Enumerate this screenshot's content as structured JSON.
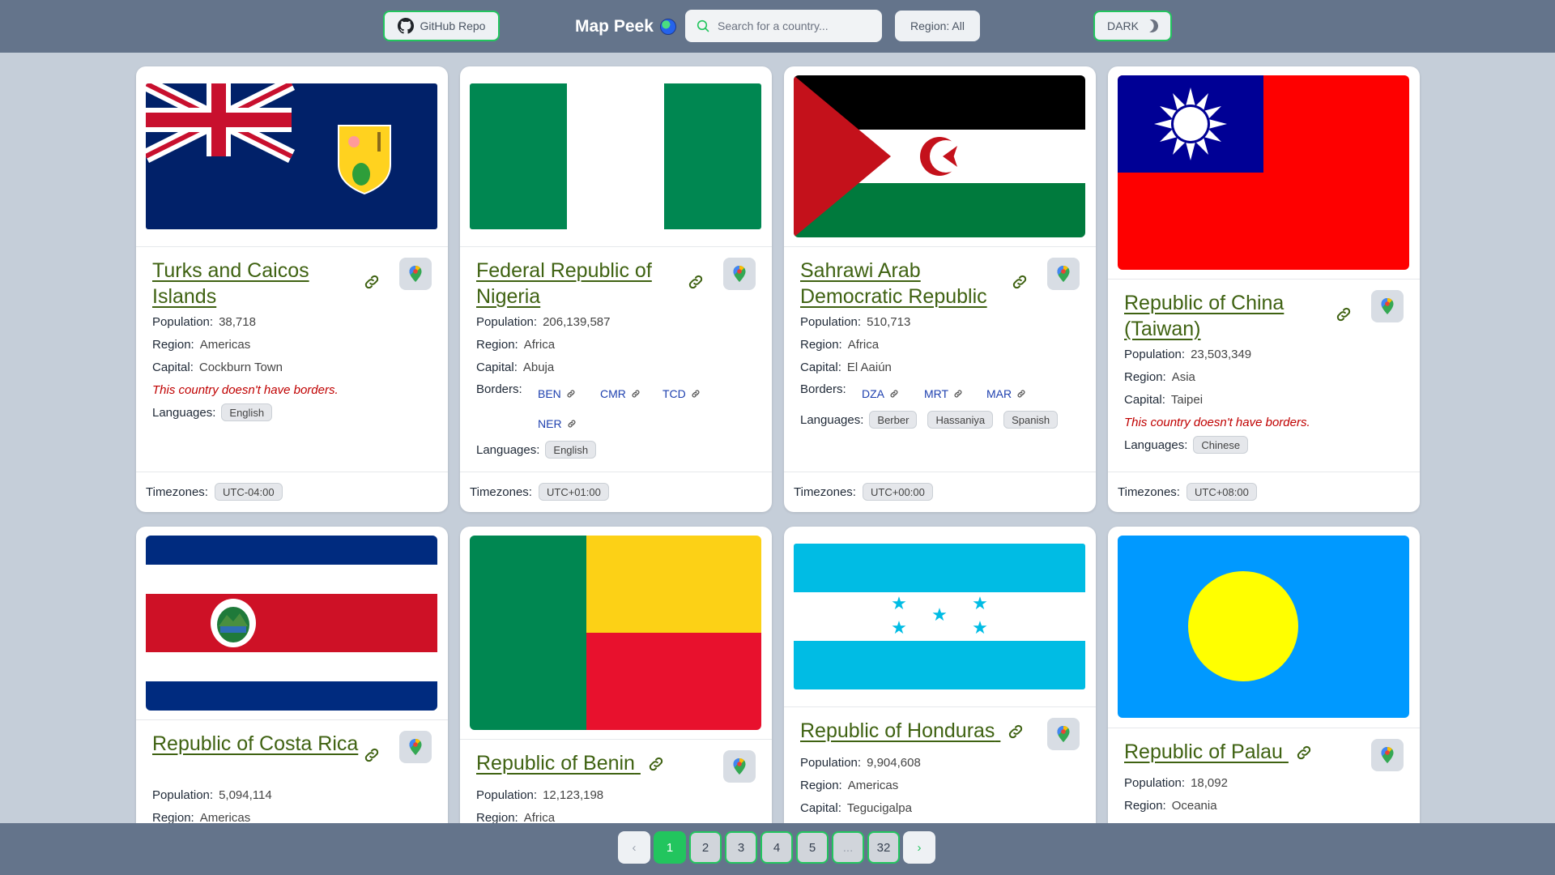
{
  "header": {
    "github_label": "GitHub Repo",
    "brand": "Map Peek",
    "search_placeholder": "Search for a country...",
    "region_label": "Region: All",
    "theme_label": "DARK"
  },
  "labels": {
    "population": "Population:",
    "region": "Region:",
    "capital": "Capital:",
    "borders": "Borders:",
    "languages": "Languages:",
    "timezones": "Timezones:",
    "no_borders": "This country doesn't have borders."
  },
  "cards": [
    {
      "name": "Turks and Caicos Islands",
      "population": "38,718",
      "region": "Americas",
      "capital": "Cockburn Town",
      "borders": [],
      "languages": [
        "English"
      ],
      "timezones": [
        "UTC-04:00"
      ]
    },
    {
      "name": "Federal Republic of Nigeria",
      "population": "206,139,587",
      "region": "Africa",
      "capital": "Abuja",
      "borders": [
        "BEN",
        "CMR",
        "TCD",
        "NER"
      ],
      "languages": [
        "English"
      ],
      "timezones": [
        "UTC+01:00"
      ]
    },
    {
      "name": "Sahrawi Arab Democratic Republic",
      "population": "510,713",
      "region": "Africa",
      "capital": "El Aaiún",
      "borders": [
        "DZA",
        "MRT",
        "MAR"
      ],
      "languages": [
        "Berber",
        "Hassaniya",
        "Spanish"
      ],
      "timezones": [
        "UTC+00:00"
      ]
    },
    {
      "name": "Republic of China (Taiwan)",
      "population": "23,503,349",
      "region": "Asia",
      "capital": "Taipei",
      "borders": [],
      "languages": [
        "Chinese"
      ],
      "timezones": [
        "UTC+08:00"
      ]
    },
    {
      "name": "Republic of Costa Rica",
      "population": "5,094,114",
      "region": "Americas"
    },
    {
      "name": "Republic of Benin",
      "population": "12,123,198",
      "region": "Africa"
    },
    {
      "name": "Republic of Honduras",
      "population": "9,904,608",
      "region": "Americas",
      "capital": "Tegucigalpa"
    },
    {
      "name": "Republic of Palau",
      "population": "18,092",
      "region": "Oceania"
    }
  ],
  "pagination": {
    "prev": "‹",
    "pages": [
      "1",
      "2",
      "3",
      "4",
      "5",
      "...",
      "32"
    ],
    "next": "›",
    "active": "1"
  },
  "colors": {
    "header_bg": "#64748b",
    "page_bg": "#c5ced9",
    "accent_green": "#22c55e",
    "title_green": "#3f6212",
    "no_border_red": "#c00000"
  }
}
